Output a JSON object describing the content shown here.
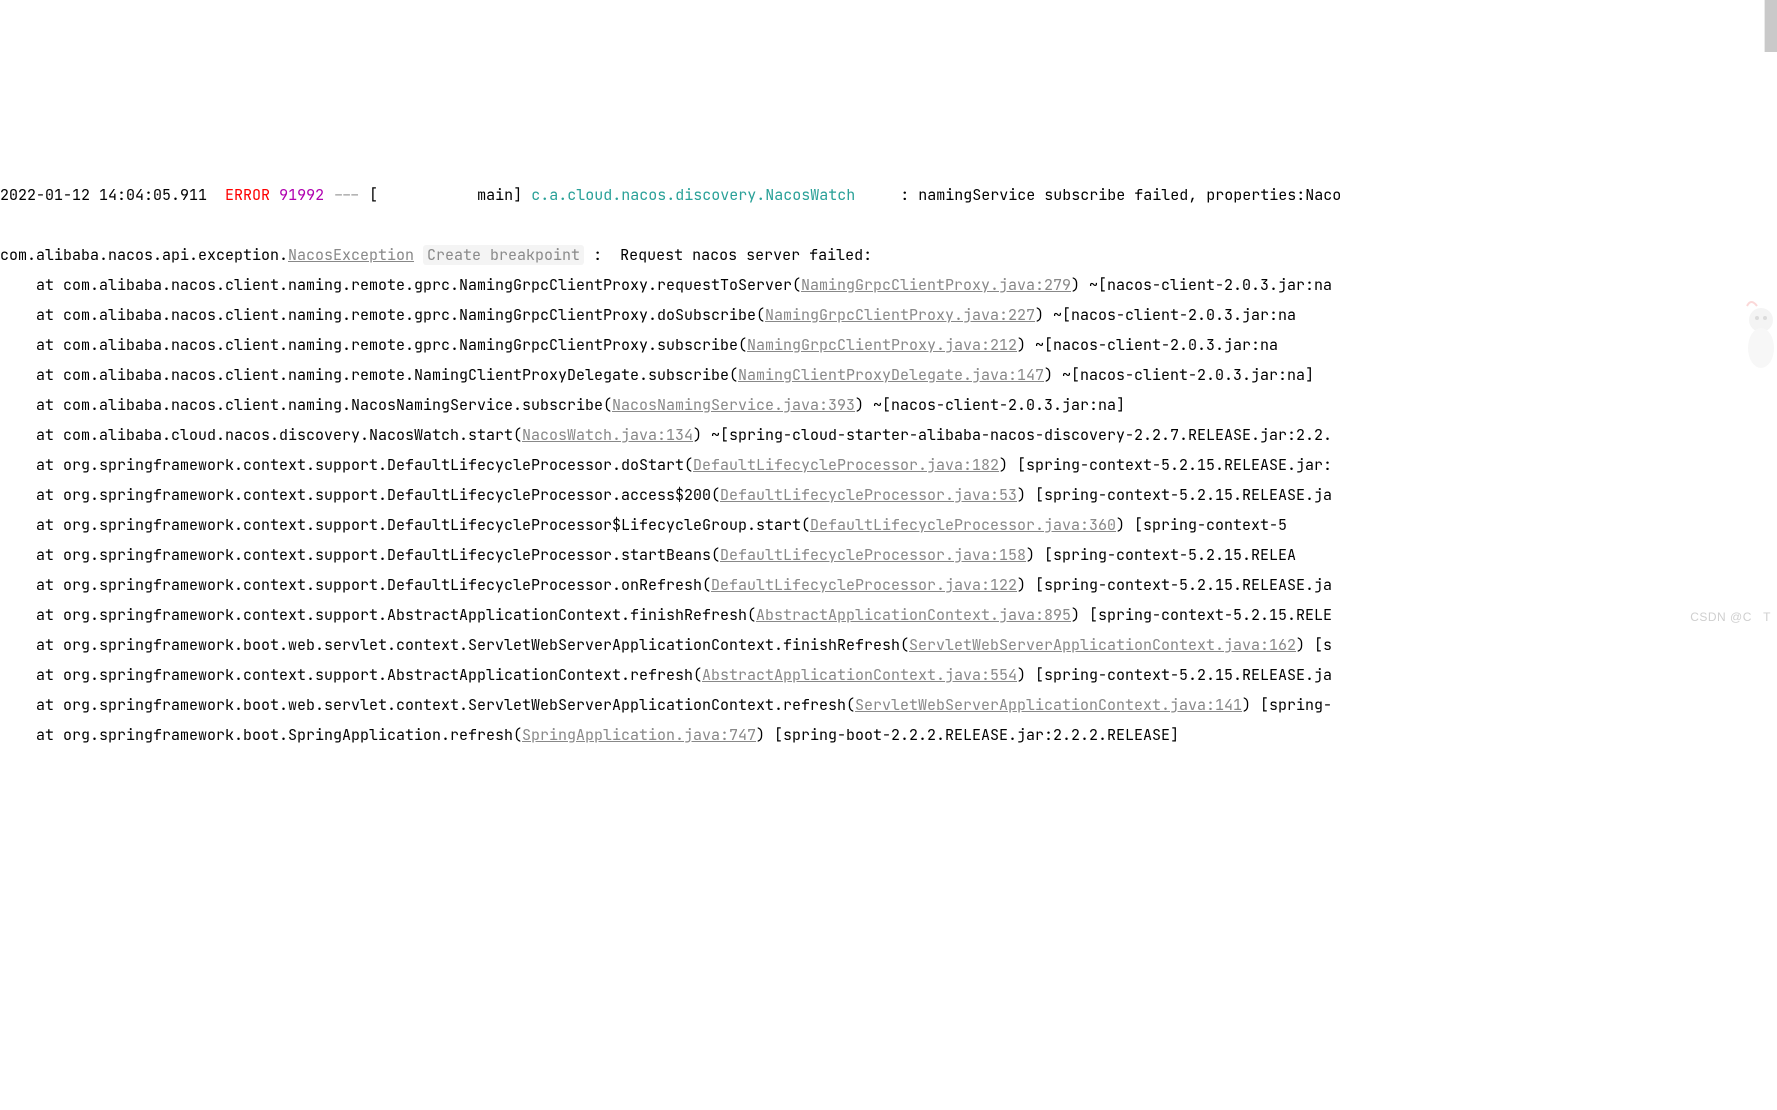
{
  "header": {
    "timestamp": "2022-01-12 14:04:05.911",
    "level": "ERROR",
    "pid": "91992",
    "separator": "---",
    "thread_open": "[",
    "thread": "           main",
    "thread_close": "]",
    "logger": "c.a.cloud.nacos.discovery.NacosWatch    ",
    "colon": " : ",
    "message": "namingService subscribe failed, properties:Naco"
  },
  "exception": {
    "pre": "com.alibaba.nacos.api.exception.",
    "class_link": "NacosException",
    "hint": "Create breakpoint",
    "post": " :  Request nacos server failed: "
  },
  "frames": [
    {
      "at": "    at ",
      "method": "com.alibaba.nacos.client.naming.remote.gprc.NamingGrpcClientProxy.requestToServer(",
      "link": "NamingGrpcClientProxy.java:279",
      "after": ") ~[nacos-client-2.0.3.jar:na"
    },
    {
      "at": "    at ",
      "method": "com.alibaba.nacos.client.naming.remote.gprc.NamingGrpcClientProxy.doSubscribe(",
      "link": "NamingGrpcClientProxy.java:227",
      "after": ") ~[nacos-client-2.0.3.jar:na"
    },
    {
      "at": "    at ",
      "method": "com.alibaba.nacos.client.naming.remote.gprc.NamingGrpcClientProxy.subscribe(",
      "link": "NamingGrpcClientProxy.java:212",
      "after": ") ~[nacos-client-2.0.3.jar:na"
    },
    {
      "at": "    at ",
      "method": "com.alibaba.nacos.client.naming.remote.NamingClientProxyDelegate.subscribe(",
      "link": "NamingClientProxyDelegate.java:147",
      "after": ") ~[nacos-client-2.0.3.jar:na]"
    },
    {
      "at": "    at ",
      "method": "com.alibaba.nacos.client.naming.NacosNamingService.subscribe(",
      "link": "NacosNamingService.java:393",
      "after": ") ~[nacos-client-2.0.3.jar:na]"
    },
    {
      "at": "    at ",
      "method": "com.alibaba.cloud.nacos.discovery.NacosWatch.start(",
      "link": "NacosWatch.java:134",
      "after": ") ~[spring-cloud-starter-alibaba-nacos-discovery-2.2.7.RELEASE.jar:2.2."
    },
    {
      "at": "    at ",
      "method": "org.springframework.context.support.DefaultLifecycleProcessor.doStart(",
      "link": "DefaultLifecycleProcessor.java:182",
      "after": ") [spring-context-5.2.15.RELEASE.jar:"
    },
    {
      "at": "    at ",
      "method": "org.springframework.context.support.DefaultLifecycleProcessor.access$200(",
      "link": "DefaultLifecycleProcessor.java:53",
      "after": ") [spring-context-5.2.15.RELEASE.ja"
    },
    {
      "at": "    at ",
      "method": "org.springframework.context.support.DefaultLifecycleProcessor$LifecycleGroup.start(",
      "link": "DefaultLifecycleProcessor.java:360",
      "after": ") [spring-context-5"
    },
    {
      "at": "    at ",
      "method": "org.springframework.context.support.DefaultLifecycleProcessor.startBeans(",
      "link": "DefaultLifecycleProcessor.java:158",
      "after": ") [spring-context-5.2.15.RELEA"
    },
    {
      "at": "    at ",
      "method": "org.springframework.context.support.DefaultLifecycleProcessor.onRefresh(",
      "link": "DefaultLifecycleProcessor.java:122",
      "after": ") [spring-context-5.2.15.RELEASE.ja"
    },
    {
      "at": "    at ",
      "method": "org.springframework.context.support.AbstractApplicationContext.finishRefresh(",
      "link": "AbstractApplicationContext.java:895",
      "after": ") [spring-context-5.2.15.RELE"
    },
    {
      "at": "    at ",
      "method": "org.springframework.boot.web.servlet.context.ServletWebServerApplicationContext.finishRefresh(",
      "link": "ServletWebServerApplicationContext.java:162",
      "after": ") [s"
    },
    {
      "at": "    at ",
      "method": "org.springframework.context.support.AbstractApplicationContext.refresh(",
      "link": "AbstractApplicationContext.java:554",
      "after": ") [spring-context-5.2.15.RELEASE.ja"
    },
    {
      "at": "    at ",
      "method": "org.springframework.boot.web.servlet.context.ServletWebServerApplicationContext.refresh(",
      "link": "ServletWebServerApplicationContext.java:141",
      "after": ") [spring-"
    },
    {
      "at": "    at ",
      "method": "org.springframework.boot.SpringApplication.refresh(",
      "link": "SpringApplication.java:747",
      "after": ") [spring-boot-2.2.2.RELEASE.jar:2.2.2.RELEASE]"
    }
  ],
  "caret_row": 6,
  "watermark": "CSDN @C   T"
}
